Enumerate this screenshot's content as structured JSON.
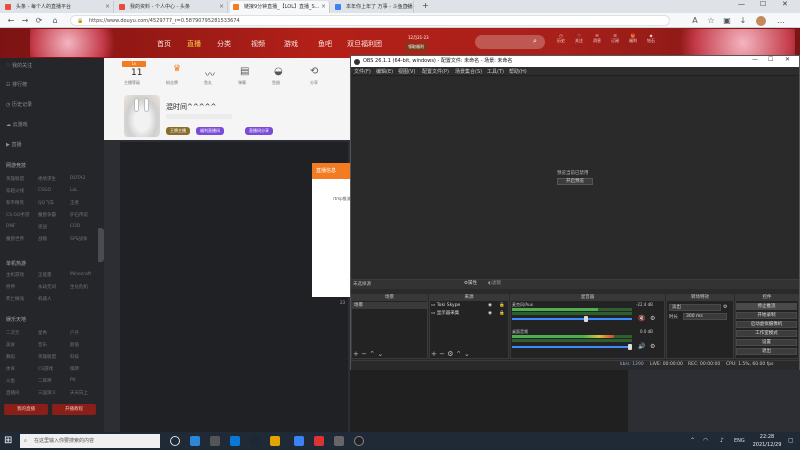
{
  "browser": {
    "tabs": [
      {
        "label": "头条 - 每个人的直播平台",
        "color": "#e94b3c"
      },
      {
        "label": "我的资料 - 个人中心 - 头条",
        "color": "#e94b3c"
      },
      {
        "label": "链接9分钟直播_【LOL】直播_S...",
        "color": "#f37c22"
      },
      {
        "label": "本年你上年了 万事 - 斗鱼直播",
        "color": "#3b82f6"
      }
    ],
    "url": "https://www.douyu.com/4529777_r=0.5879079528153367​4",
    "new_tab": "+",
    "window_controls": [
      "—",
      "☐",
      "✕"
    ]
  },
  "site": {
    "nav": [
      "首页",
      "直播",
      "分类",
      "视频",
      "游戏",
      "鱼吧",
      "双旦福利团"
    ],
    "nav_active_index": 1,
    "banner_date": "12月21-23",
    "banner_cta": "领取福利",
    "user_icons": [
      "历史",
      "关注",
      "消息",
      "订阅",
      "福利",
      "钻石"
    ]
  },
  "sidebar": {
    "items": [
      "我的关注",
      "排行榜",
      "历史记录",
      "云游戏",
      "直播"
    ],
    "section1": "网游竞技",
    "grid1": [
      "英雄联盟",
      "绝地求生",
      "DOTA2",
      "穿越火线",
      "CSGO",
      "LoL",
      "和平精英",
      "QQ飞车",
      "王者",
      "CS:GO手游",
      "魔兽争霸",
      "炉石传说",
      "DNF",
      "逆战",
      "COD",
      "魔兽世界",
      "战锤",
      "SPS战争"
    ],
    "section2": "单机热游",
    "grid2": [
      "主机游戏",
      "正能量",
      "Minecraft",
      "原神",
      "永劫无间",
      "生化危机",
      "死亡搁浅",
      "机器人"
    ],
    "section3": "娱乐天地",
    "grid3": [
      "二次元",
      "星秀",
      "户外",
      "美食",
      "音乐",
      "颜值",
      "舞蹈",
      "英雄联盟",
      "科技",
      "体育",
      "CS游戏",
      "棋牌",
      "斗鱼",
      "二郎神",
      "PK",
      "直播间",
      "三国演义",
      "天天向上"
    ],
    "footer_buttons": [
      "我的直播",
      "开播教程"
    ]
  },
  "profile": {
    "stats": [
      "11",
      "0",
      "",
      "",
      "",
      ""
    ],
    "stat_labels": [
      "主播等级",
      "粉丝牌",
      "鱼丸",
      "弹幕",
      "鱼翅",
      "分享"
    ],
    "name": "混时间^^^^^",
    "tags": [
      "王牌主播",
      "福利直播间",
      "直播间分享"
    ]
  },
  "popup": {
    "title": "直播信息",
    "text": "rtmp推流"
  },
  "obs": {
    "title": "OBS 26.1.1 (64-bit, windows) - 配置文件: 未命名 - 场景: 未命名",
    "menu": [
      "文件(F)",
      "编辑(E)",
      "视图(V)",
      "配置文件(P)",
      "场景集合(S)",
      "工具(T)",
      "帮助(H)"
    ],
    "preview_disabled_line1": "预览当前已禁用",
    "preview_disabled_button": "开启预览",
    "no_source_selected": "未选择源",
    "properties_button": "属性",
    "filters_button": "滤镜",
    "scenes_header": "场景",
    "scenes": [
      "场景"
    ],
    "sources_header": "来源",
    "sources": [
      "Toki Skype",
      "显示器采集"
    ],
    "mixer_header": "混音器",
    "mixer_channels": [
      {
        "name": "麦克风/Aux",
        "db": "-22.4 dB",
        "level": 0.72
      },
      {
        "name": "桌面音频",
        "db": "0.0 dB",
        "level": 0.85
      }
    ],
    "transitions_header": "转场特效",
    "transition_value": "淡出",
    "duration_label": "时长",
    "duration_value": "300 ms",
    "controls_header": "控件",
    "controls": [
      "停止推流",
      "开始录制",
      "启动虚拟摄像机",
      "工作室模式",
      "设置",
      "退出"
    ],
    "status": {
      "live_label": "LIVE: 00:00:00",
      "rec_label": "REC: 00:00:00",
      "cpu": "CPU: 1.5%, 60.00 fps",
      "bitrate": "kb/s: 1290"
    }
  },
  "taskbar": {
    "search_placeholder": "在这里输入你要搜索的内容",
    "tray_lang": "ENG",
    "time": "22:28",
    "date": "2021/12/29"
  },
  "colors": {
    "accent": "#f37c22",
    "site_red": "#b32018",
    "obs_dark": "#2a2a2a",
    "meter_green": "#4caf50",
    "meter_yellow": "#d8c43b",
    "meter_red": "#c94a3a",
    "meter_blue": "#3d8bff"
  }
}
